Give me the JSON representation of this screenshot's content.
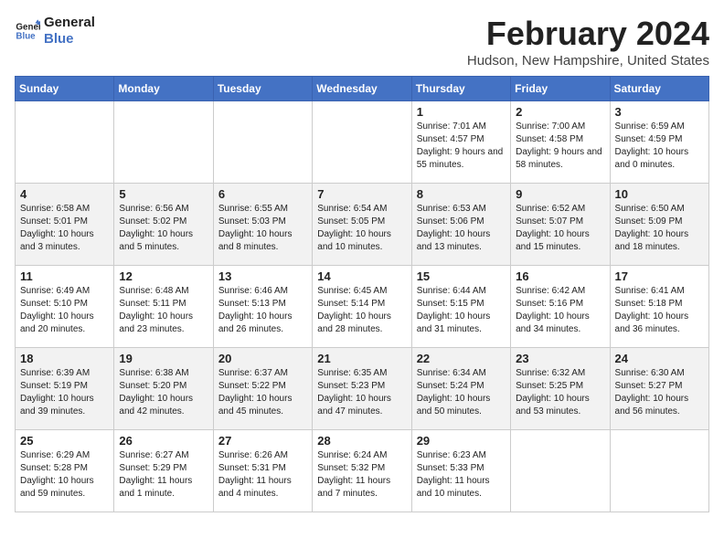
{
  "logo": {
    "line1": "General",
    "line2": "Blue"
  },
  "title": "February 2024",
  "location": "Hudson, New Hampshire, United States",
  "days_header": [
    "Sunday",
    "Monday",
    "Tuesday",
    "Wednesday",
    "Thursday",
    "Friday",
    "Saturday"
  ],
  "weeks": [
    [
      {
        "day": "",
        "sunrise": "",
        "sunset": "",
        "daylight": ""
      },
      {
        "day": "",
        "sunrise": "",
        "sunset": "",
        "daylight": ""
      },
      {
        "day": "",
        "sunrise": "",
        "sunset": "",
        "daylight": ""
      },
      {
        "day": "",
        "sunrise": "",
        "sunset": "",
        "daylight": ""
      },
      {
        "day": "1",
        "sunrise": "Sunrise: 7:01 AM",
        "sunset": "Sunset: 4:57 PM",
        "daylight": "Daylight: 9 hours and 55 minutes."
      },
      {
        "day": "2",
        "sunrise": "Sunrise: 7:00 AM",
        "sunset": "Sunset: 4:58 PM",
        "daylight": "Daylight: 9 hours and 58 minutes."
      },
      {
        "day": "3",
        "sunrise": "Sunrise: 6:59 AM",
        "sunset": "Sunset: 4:59 PM",
        "daylight": "Daylight: 10 hours and 0 minutes."
      }
    ],
    [
      {
        "day": "4",
        "sunrise": "Sunrise: 6:58 AM",
        "sunset": "Sunset: 5:01 PM",
        "daylight": "Daylight: 10 hours and 3 minutes."
      },
      {
        "day": "5",
        "sunrise": "Sunrise: 6:56 AM",
        "sunset": "Sunset: 5:02 PM",
        "daylight": "Daylight: 10 hours and 5 minutes."
      },
      {
        "day": "6",
        "sunrise": "Sunrise: 6:55 AM",
        "sunset": "Sunset: 5:03 PM",
        "daylight": "Daylight: 10 hours and 8 minutes."
      },
      {
        "day": "7",
        "sunrise": "Sunrise: 6:54 AM",
        "sunset": "Sunset: 5:05 PM",
        "daylight": "Daylight: 10 hours and 10 minutes."
      },
      {
        "day": "8",
        "sunrise": "Sunrise: 6:53 AM",
        "sunset": "Sunset: 5:06 PM",
        "daylight": "Daylight: 10 hours and 13 minutes."
      },
      {
        "day": "9",
        "sunrise": "Sunrise: 6:52 AM",
        "sunset": "Sunset: 5:07 PM",
        "daylight": "Daylight: 10 hours and 15 minutes."
      },
      {
        "day": "10",
        "sunrise": "Sunrise: 6:50 AM",
        "sunset": "Sunset: 5:09 PM",
        "daylight": "Daylight: 10 hours and 18 minutes."
      }
    ],
    [
      {
        "day": "11",
        "sunrise": "Sunrise: 6:49 AM",
        "sunset": "Sunset: 5:10 PM",
        "daylight": "Daylight: 10 hours and 20 minutes."
      },
      {
        "day": "12",
        "sunrise": "Sunrise: 6:48 AM",
        "sunset": "Sunset: 5:11 PM",
        "daylight": "Daylight: 10 hours and 23 minutes."
      },
      {
        "day": "13",
        "sunrise": "Sunrise: 6:46 AM",
        "sunset": "Sunset: 5:13 PM",
        "daylight": "Daylight: 10 hours and 26 minutes."
      },
      {
        "day": "14",
        "sunrise": "Sunrise: 6:45 AM",
        "sunset": "Sunset: 5:14 PM",
        "daylight": "Daylight: 10 hours and 28 minutes."
      },
      {
        "day": "15",
        "sunrise": "Sunrise: 6:44 AM",
        "sunset": "Sunset: 5:15 PM",
        "daylight": "Daylight: 10 hours and 31 minutes."
      },
      {
        "day": "16",
        "sunrise": "Sunrise: 6:42 AM",
        "sunset": "Sunset: 5:16 PM",
        "daylight": "Daylight: 10 hours and 34 minutes."
      },
      {
        "day": "17",
        "sunrise": "Sunrise: 6:41 AM",
        "sunset": "Sunset: 5:18 PM",
        "daylight": "Daylight: 10 hours and 36 minutes."
      }
    ],
    [
      {
        "day": "18",
        "sunrise": "Sunrise: 6:39 AM",
        "sunset": "Sunset: 5:19 PM",
        "daylight": "Daylight: 10 hours and 39 minutes."
      },
      {
        "day": "19",
        "sunrise": "Sunrise: 6:38 AM",
        "sunset": "Sunset: 5:20 PM",
        "daylight": "Daylight: 10 hours and 42 minutes."
      },
      {
        "day": "20",
        "sunrise": "Sunrise: 6:37 AM",
        "sunset": "Sunset: 5:22 PM",
        "daylight": "Daylight: 10 hours and 45 minutes."
      },
      {
        "day": "21",
        "sunrise": "Sunrise: 6:35 AM",
        "sunset": "Sunset: 5:23 PM",
        "daylight": "Daylight: 10 hours and 47 minutes."
      },
      {
        "day": "22",
        "sunrise": "Sunrise: 6:34 AM",
        "sunset": "Sunset: 5:24 PM",
        "daylight": "Daylight: 10 hours and 50 minutes."
      },
      {
        "day": "23",
        "sunrise": "Sunrise: 6:32 AM",
        "sunset": "Sunset: 5:25 PM",
        "daylight": "Daylight: 10 hours and 53 minutes."
      },
      {
        "day": "24",
        "sunrise": "Sunrise: 6:30 AM",
        "sunset": "Sunset: 5:27 PM",
        "daylight": "Daylight: 10 hours and 56 minutes."
      }
    ],
    [
      {
        "day": "25",
        "sunrise": "Sunrise: 6:29 AM",
        "sunset": "Sunset: 5:28 PM",
        "daylight": "Daylight: 10 hours and 59 minutes."
      },
      {
        "day": "26",
        "sunrise": "Sunrise: 6:27 AM",
        "sunset": "Sunset: 5:29 PM",
        "daylight": "Daylight: 11 hours and 1 minute."
      },
      {
        "day": "27",
        "sunrise": "Sunrise: 6:26 AM",
        "sunset": "Sunset: 5:31 PM",
        "daylight": "Daylight: 11 hours and 4 minutes."
      },
      {
        "day": "28",
        "sunrise": "Sunrise: 6:24 AM",
        "sunset": "Sunset: 5:32 PM",
        "daylight": "Daylight: 11 hours and 7 minutes."
      },
      {
        "day": "29",
        "sunrise": "Sunrise: 6:23 AM",
        "sunset": "Sunset: 5:33 PM",
        "daylight": "Daylight: 11 hours and 10 minutes."
      },
      {
        "day": "",
        "sunrise": "",
        "sunset": "",
        "daylight": ""
      },
      {
        "day": "",
        "sunrise": "",
        "sunset": "",
        "daylight": ""
      }
    ]
  ]
}
